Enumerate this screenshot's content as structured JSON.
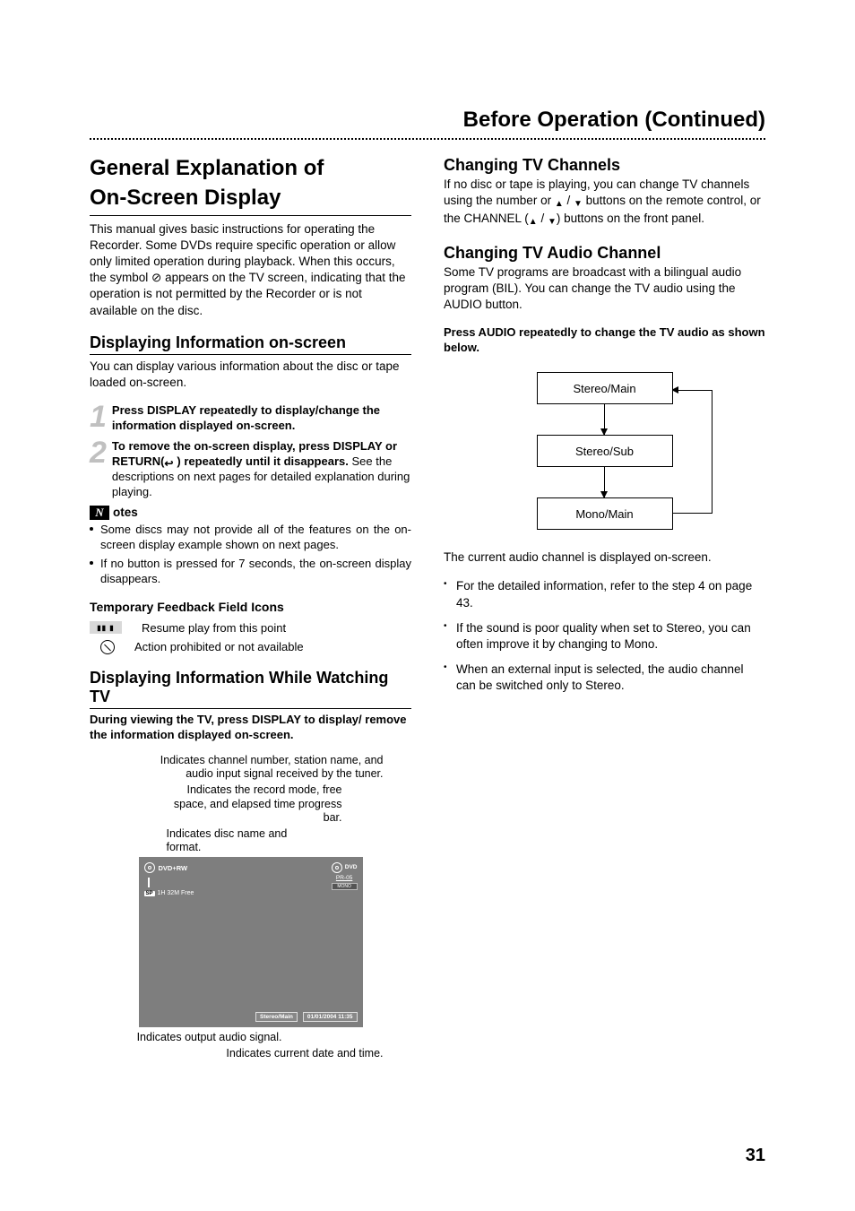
{
  "running_head": "Before Operation (Continued)",
  "left": {
    "h1_a": "General Explanation of",
    "h1_b": "On-Screen Display",
    "intro": "This manual gives basic instructions for operating the Recorder. Some DVDs require specific operation or allow only limited operation during playback. When this occurs, the symbol ⊘ appears on the TV screen, indicating that the operation is not permitted by the Recorder or is not available on the disc.",
    "h2_display": "Displaying Information on-screen",
    "display_para": "You can display various information about the disc or tape loaded on-screen.",
    "step1_num": "1",
    "step1_txt": "Press DISPLAY repeatedly to display/change the information displayed on-screen.",
    "step2_num": "2",
    "step2_bold": "To remove the on-screen display, press DISPLAY or RETURN(",
    "step2_bold_tail": ") repeatedly until it disappears.",
    "step2_rest": "See the descriptions on next pages for detailed explanation during playing.",
    "notes_letter": "N",
    "notes_label": "otes",
    "note1": "Some discs may not provide all of the features on the on-screen display example shown on next pages.",
    "note2": "If no button is pressed for 7 seconds, the on-screen display disappears.",
    "h3_icons": "Temporary Feedback Field Icons",
    "icon_resume_glyph": "▮▮ ▮",
    "icon_resume": "Resume play from this point",
    "icon_prohibit": "Action prohibited or not available",
    "h2_tv": "Displaying Information While Watching TV",
    "tv_bold": "During viewing the TV, press DISPLAY to display/ remove the information displayed on-screen.",
    "callout1": "Indicates channel number, station name, and audio input signal received by the tuner.",
    "callout2": "Indicates the record mode, free space, and elapsed time progress bar.",
    "callout3": "Indicates disc name and format.",
    "osd": {
      "format": "DVD+RW",
      "sp": "SP",
      "free": "1H 32M Free",
      "right_dvd": "DVD",
      "right_pr": "PR-05",
      "right_mono": "MONO",
      "bottom_audio": "Stereo/Main",
      "bottom_date": "01/01/2004 11:35"
    },
    "callout4": "Indicates output audio signal.",
    "callout5": "Indicates current date and time."
  },
  "right": {
    "h2_channels": "Changing TV Channels",
    "channels_para_a": "If no disc or tape is playing, you can change TV channels using the number or ",
    "channels_para_b": " buttons on the remote control, or the CHANNEL (",
    "channels_para_c": ") buttons on the front panel.",
    "h2_audio": "Changing TV Audio Channel",
    "audio_para": "Some TV programs are broadcast with a bilingual audio program (BIL). You can change the TV audio using the AUDIO button.",
    "audio_bold": "Press AUDIO repeatedly to change the TV audio as shown below.",
    "flow1": "Stereo/Main",
    "flow2": "Stereo/Sub",
    "flow3": "Mono/Main",
    "after_flow": "The current audio channel is displayed on-screen.",
    "d1": "For the detailed information, refer to the step 4 on page 43.",
    "d2": "If the sound is poor quality when set to Stereo, you can often improve it by changing to Mono.",
    "d3": "When an external input is selected, the audio channel can be switched only to Stereo."
  },
  "page_number": "31"
}
